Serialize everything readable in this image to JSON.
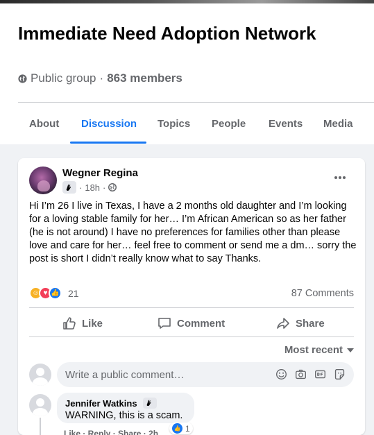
{
  "group": {
    "title": "Immediate Need Adoption Network",
    "privacy": "Public group",
    "separator": "·",
    "members": "863 members"
  },
  "tabs": [
    {
      "label": "About"
    },
    {
      "label": "Discussion"
    },
    {
      "label": "Topics"
    },
    {
      "label": "People"
    },
    {
      "label": "Events"
    },
    {
      "label": "Media"
    }
  ],
  "post": {
    "author": "Wegner Regina",
    "time": "18h",
    "body": "Hi I’m 26 I live in Texas, I have a 2 months old daughter and I’m looking for a loving stable family for her… I’m African American so as her father (he is not around) I have no preferences for families other than please love and care for her… feel free to comment or send me a dm… sorry the post is short I didn’t really know what to say Thanks.",
    "reaction_count": "21",
    "comment_count": "87 Comments",
    "actions": {
      "like": "Like",
      "comment": "Comment",
      "share": "Share"
    },
    "sort_label": "Most recent",
    "comment_placeholder": "Write a public comment…"
  },
  "comments": [
    {
      "author": "Jennifer Watkins",
      "text": "WARNING, this is a scam.",
      "like_count": "1",
      "actions": "Like · Reply · Share · 2h"
    }
  ],
  "colors": {
    "accent": "#1877f2",
    "muted": "#65676b",
    "feed_bg": "#f0f2f5"
  }
}
